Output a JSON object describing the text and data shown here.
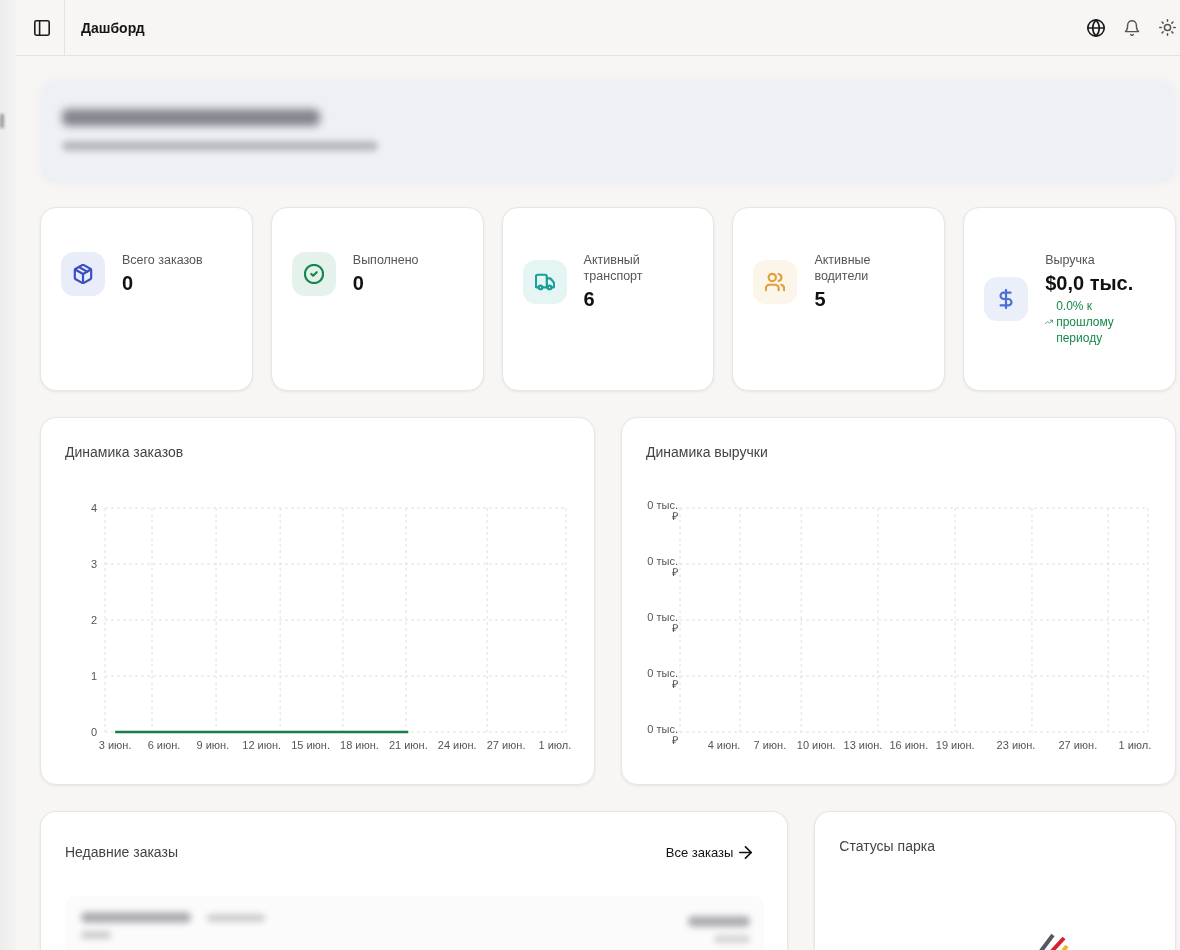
{
  "header": {
    "title": "Дашборд"
  },
  "stats": [
    {
      "label": "Всего заказов",
      "value": "0",
      "color": "#3b4fc4"
    },
    {
      "label": "Выполнено",
      "value": "0",
      "color": "#17874b"
    },
    {
      "label": "Активный транспорт",
      "value": "6",
      "color": "#17a096"
    },
    {
      "label": "Активные водители",
      "value": "5",
      "color": "#e3a03a"
    },
    {
      "label": "Выручка",
      "value": "$0,0 тыс.",
      "color": "#4a6fd6",
      "trend": "0.0% к прошлому периоду"
    }
  ],
  "orders_chart": {
    "title": "Динамика заказов",
    "chart_data": {
      "type": "line",
      "categories": [
        "3 июн.",
        "6 июн.",
        "9 июн.",
        "12 июн.",
        "15 июн.",
        "18 июн.",
        "21 июн.",
        "24 июн.",
        "27 июн.",
        "1 июл."
      ],
      "series": [
        {
          "color": "#16804a",
          "values": [
            0,
            0,
            0,
            0,
            0,
            0,
            0,
            null,
            null,
            null
          ]
        }
      ],
      "ylim": [
        0,
        4
      ],
      "yticks": [
        0,
        1,
        2,
        3,
        4
      ],
      "grid": true
    }
  },
  "revenue_chart": {
    "title": "Динамика выручки",
    "y_axis_labels": [
      "0 тыс. ₽",
      "0 тыс. ₽",
      "0 тыс. ₽",
      "0 тыс. ₽",
      "0 тыс. ₽"
    ],
    "x_axis_labels": [
      "4 июн.",
      "7 июн.",
      "10 июн.",
      "13 июн.",
      "16 июн.",
      "19 июн.",
      "23 июн.",
      "27 июн.",
      "1 июл."
    ]
  },
  "recent_orders": {
    "title": "Недавние заказы",
    "link": "Все заказы"
  },
  "fleet_status": {
    "title": "Статусы парка",
    "segments": [
      {
        "color": "#55595f"
      },
      {
        "color": "#d8202c"
      },
      {
        "color": "#f0b429"
      }
    ]
  }
}
